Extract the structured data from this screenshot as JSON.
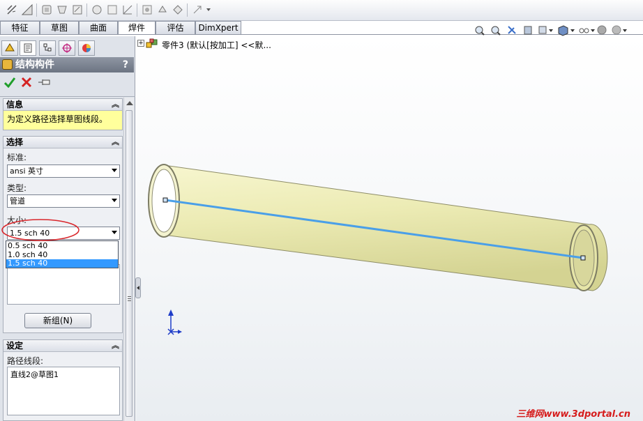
{
  "tabs": [
    "特征",
    "草图",
    "曲面",
    "焊件",
    "评估",
    "DimXpert"
  ],
  "active_tab": 3,
  "feature_tree": {
    "part_label": "零件3",
    "config_label": "(默认[按加工] <<默..."
  },
  "panel": {
    "title": "结构构件",
    "help": "?",
    "info": {
      "header": "信息",
      "message": "为定义路径选择草图线段。"
    },
    "selection": {
      "header": "选择",
      "standard_label": "标准:",
      "standard_value": "ansi 英寸",
      "type_label": "类型:",
      "type_value": "管道",
      "size_label": "大小:",
      "size_value": "1.5 sch 40",
      "size_options": [
        "0.5 sch 40",
        "1.0 sch 40",
        "1.5 sch 40"
      ],
      "size_selected_index": 2,
      "new_group_button": "新组(N)"
    },
    "settings": {
      "header": "设定",
      "path_label": "路径线段:",
      "path_items": [
        "直线2@草图1"
      ]
    }
  },
  "watermark": "三维网www.3dportal.cn",
  "colors": {
    "tube_fill": "#ecebb4",
    "path_line": "#4a9fe8",
    "info_bg": "#ffff9c",
    "selected_option_bg": "#3399ff",
    "highlight_ellipse": "#d9262b",
    "watermark": "#d61c1c"
  }
}
